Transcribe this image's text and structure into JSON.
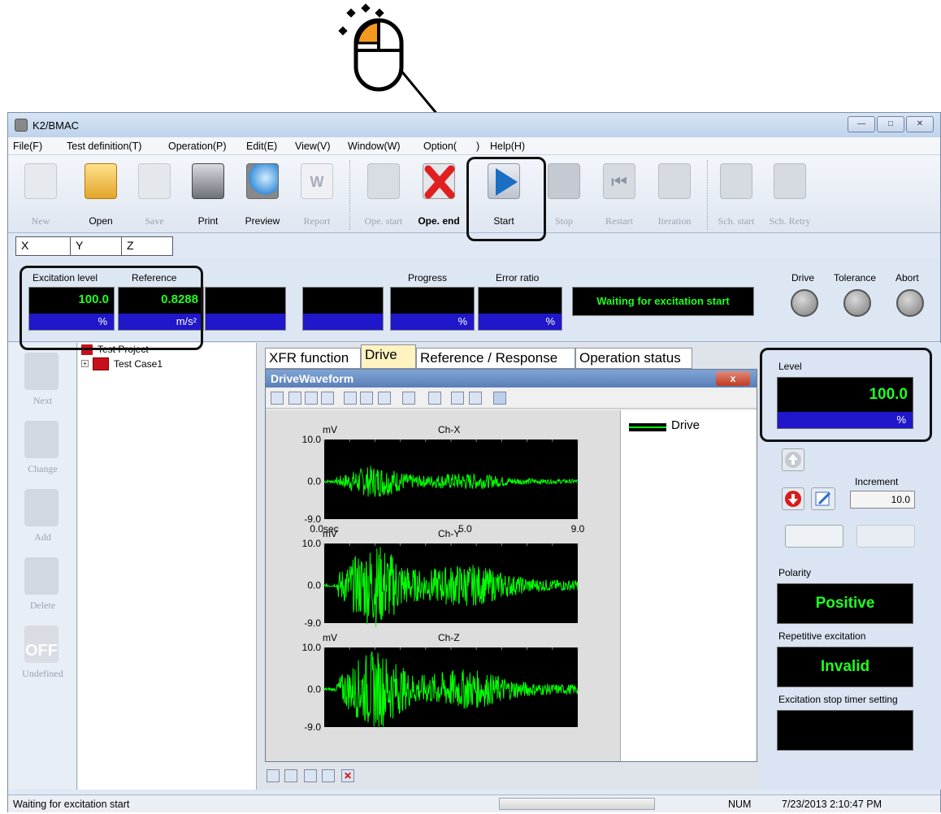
{
  "window": {
    "title": "K2/BMAC",
    "controls": [
      "—",
      "□",
      "✕"
    ]
  },
  "menu": [
    "File(F)",
    "Test definition(T)",
    "Operation(P)",
    "Edit(E)",
    "View(V)",
    "Window(W)",
    "Option(",
    ")",
    "Help(H)"
  ],
  "toolbar": {
    "new": "New",
    "open": "Open",
    "save": "Save",
    "print": "Print",
    "preview": "Preview",
    "report": "Report",
    "ope_start": "Ope. start",
    "ope_end": "Ope. end",
    "start": "Start",
    "stop": "Stop",
    "restart": "Restart",
    "iteration": "Iteration",
    "sch_start": "Sch. start",
    "sch_retry": "Sch. Retry"
  },
  "axis_tabs": [
    "X",
    "Y",
    "Z"
  ],
  "data_panel": {
    "excitation_label": "Excitation level",
    "excitation_value": "100.0",
    "excitation_unit": "%",
    "reference_label": "Reference",
    "reference_value": "0.8288",
    "reference_unit": "m/s²",
    "progress_label": "Progress",
    "progress_unit": "%",
    "error_label": "Error ratio",
    "error_unit": "%",
    "status_message": "Waiting for excitation start",
    "drive_label": "Drive",
    "tolerance_label": "Tolerance",
    "abort_label": "Abort"
  },
  "left_panel": [
    "Next",
    "Change",
    "Add",
    "Delete",
    "Undefined"
  ],
  "off_icon_text": "OFF",
  "tree": {
    "project": "Test Project",
    "case": "Test Case1"
  },
  "center_tabs": [
    "XFR function",
    "Drive",
    "Reference / Response",
    "Operation status"
  ],
  "drive_window": {
    "title": "DriveWaveform",
    "close": "x",
    "legend": "Drive"
  },
  "chart_data": [
    {
      "type": "line",
      "title": "Ch-X",
      "xlabel": "sec",
      "ylabel": "mV",
      "xlim": [
        0.0,
        9.0
      ],
      "ylim": [
        -9.0,
        10.0
      ],
      "yticks": [
        "10.0",
        "0.0",
        "-9.0"
      ],
      "xticks": [
        "0.0sec",
        "5.0",
        "9.0"
      ],
      "series": [
        {
          "name": "Drive",
          "color": "#00ff00",
          "amplitude": 0.35
        }
      ]
    },
    {
      "type": "line",
      "title": "Ch-Y",
      "xlabel": "sec",
      "ylabel": "mV",
      "xlim": [
        0.0,
        9.0
      ],
      "ylim": [
        -9.0,
        10.0
      ],
      "yticks": [
        "10.0",
        "0.0",
        "-9.0"
      ],
      "series": [
        {
          "name": "Drive",
          "color": "#00ff00",
          "amplitude": 0.9
        }
      ]
    },
    {
      "type": "line",
      "title": "Ch-Z",
      "xlabel": "sec",
      "ylabel": "mV",
      "xlim": [
        0.0,
        9.0
      ],
      "ylim": [
        -9.0,
        10.0
      ],
      "yticks": [
        "10.0",
        "0.0",
        "-9.0"
      ],
      "series": [
        {
          "name": "Drive",
          "color": "#00ff00",
          "amplitude": 0.85
        }
      ]
    }
  ],
  "right_panel": {
    "level_label": "Level",
    "level_value": "100.0",
    "level_unit": "%",
    "increment_label": "Increment",
    "increment_value": "10.0",
    "polarity_label": "Polarity",
    "polarity_value": "Positive",
    "repetitive_label": "Repetitive excitation",
    "repetitive_value": "Invalid",
    "timer_label": "Excitation stop timer setting",
    "timer_value": ""
  },
  "status_bar": {
    "message": "Waiting for excitation start",
    "num": "NUM",
    "datetime": "7/23/2013  2:10:47 PM"
  },
  "colors": {
    "led_green": "#1eff1e",
    "unit_blue": "#1f17c9",
    "mouse_orange": "#f39a1e",
    "play_blue": "#1a6fc2"
  }
}
